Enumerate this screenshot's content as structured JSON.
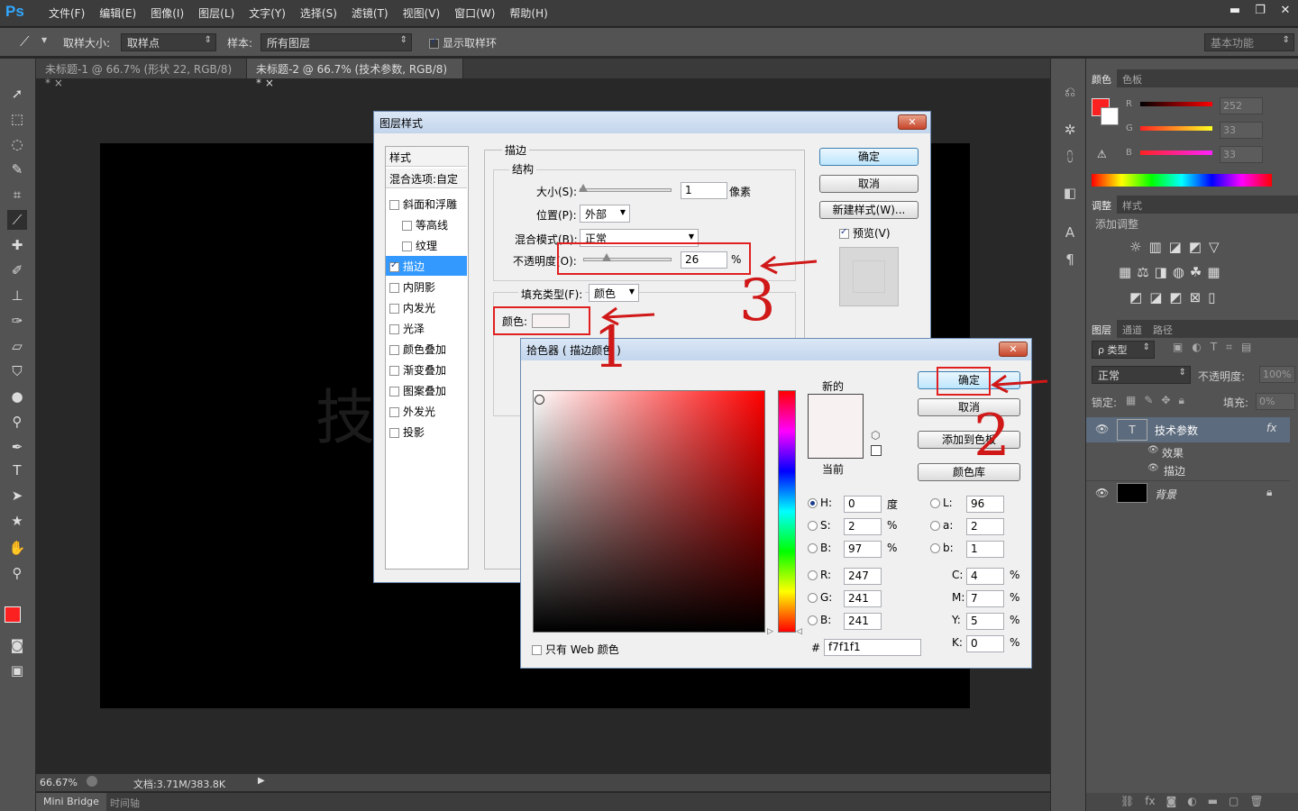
{
  "app": {
    "logo": "Ps"
  },
  "menu": [
    "文件(F)",
    "编辑(E)",
    "图像(I)",
    "图层(L)",
    "文字(Y)",
    "选择(S)",
    "滤镜(T)",
    "视图(V)",
    "窗口(W)",
    "帮助(H)"
  ],
  "window_buttons": [
    "▬",
    "❐",
    "✕"
  ],
  "options": {
    "sample_size_label": "取样大小:",
    "sample_size_value": "取样点",
    "sample_label": "样本:",
    "sample_value": "所有图层",
    "show_ring_label": "显示取样环",
    "workspace": "基本功能"
  },
  "tabs": [
    {
      "label": "未标题-1 @ 66.7% (形状 22, RGB/8) *",
      "close": "×"
    },
    {
      "label": "未标题-2 @ 66.7% (技术参数, RGB/8) *",
      "close": "×"
    }
  ],
  "canvas": {
    "text": "技"
  },
  "status": {
    "zoom": "66.67%",
    "doc": "文档:3.71M/383.8K"
  },
  "bottom_tabs": [
    "Mini Bridge",
    "时间轴"
  ],
  "color_panel": {
    "tabs": [
      "颜色",
      "色板"
    ],
    "channels": [
      {
        "label": "R",
        "value": "252"
      },
      {
        "label": "G",
        "value": "33"
      },
      {
        "label": "B",
        "value": "33"
      }
    ],
    "fg_color": "#fc2121"
  },
  "adjust_panel": {
    "tabs": [
      "调整",
      "样式"
    ],
    "title": "添加调整"
  },
  "layers_panel": {
    "tabs": [
      "图层",
      "通道",
      "路径"
    ],
    "filter": "ρ 类型",
    "blend": "正常",
    "opacity_label": "不透明度:",
    "opacity": "100%",
    "lock_label": "锁定:",
    "fill_label": "填充:",
    "fill": "0%",
    "layers": [
      {
        "name": "技术参数",
        "badge": "fx",
        "thumb": "T"
      },
      {
        "name": "效果"
      },
      {
        "name": "描边"
      },
      {
        "name": "背景"
      }
    ]
  },
  "layer_style": {
    "title": "图层样式",
    "list_header": "样式",
    "blend_options": "混合选项:自定",
    "items": [
      {
        "label": "斜面和浮雕",
        "checked": false
      },
      {
        "label": "等高线",
        "checked": false
      },
      {
        "label": "纹理",
        "checked": false
      },
      {
        "label": "描边",
        "checked": true,
        "active": true
      },
      {
        "label": "内阴影",
        "checked": false
      },
      {
        "label": "内发光",
        "checked": false
      },
      {
        "label": "光泽",
        "checked": false
      },
      {
        "label": "颜色叠加",
        "checked": false
      },
      {
        "label": "渐变叠加",
        "checked": false
      },
      {
        "label": "图案叠加",
        "checked": false
      },
      {
        "label": "外发光",
        "checked": false
      },
      {
        "label": "投影",
        "checked": false
      }
    ],
    "section": "描边",
    "structure": "结构",
    "size_label": "大小(S):",
    "size_value": "1",
    "size_unit": "像素",
    "position_label": "位置(P):",
    "position_value": "外部",
    "blend_label": "混合模式(B):",
    "blend_value": "正常",
    "opacity_label": "不透明度(O):",
    "opacity_value": "26",
    "opacity_unit": "%",
    "fill_type_label": "填充类型(F):",
    "fill_type_value": "颜色",
    "color_label": "颜色:",
    "ok": "确定",
    "cancel": "取消",
    "new_style": "新建样式(W)...",
    "preview": "预览(V)"
  },
  "picker": {
    "title": "拾色器 ( 描边颜色 )",
    "new_label": "新的",
    "current_label": "当前",
    "ok": "确定",
    "cancel": "取消",
    "add_swatch": "添加到色板",
    "library": "颜色库",
    "web_only": "只有 Web 颜色",
    "hsb": [
      {
        "label": "H:",
        "value": "0",
        "unit": "度",
        "on": true
      },
      {
        "label": "S:",
        "value": "2",
        "unit": "%"
      },
      {
        "label": "B:",
        "value": "97",
        "unit": "%"
      }
    ],
    "rgb": [
      {
        "label": "R:",
        "value": "247"
      },
      {
        "label": "G:",
        "value": "241"
      },
      {
        "label": "B:",
        "value": "241"
      }
    ],
    "lab": [
      {
        "label": "L:",
        "value": "96"
      },
      {
        "label": "a:",
        "value": "2"
      },
      {
        "label": "b:",
        "value": "1"
      }
    ],
    "cmyk": [
      {
        "label": "C:",
        "value": "4",
        "unit": "%"
      },
      {
        "label": "M:",
        "value": "7",
        "unit": "%"
      },
      {
        "label": "Y:",
        "value": "5",
        "unit": "%"
      },
      {
        "label": "K:",
        "value": "0",
        "unit": "%"
      }
    ],
    "hex_label": "#",
    "hex": "f7f1f1",
    "new_color": "#f7f1f1"
  },
  "annotations": [
    "1",
    "2",
    "3"
  ]
}
